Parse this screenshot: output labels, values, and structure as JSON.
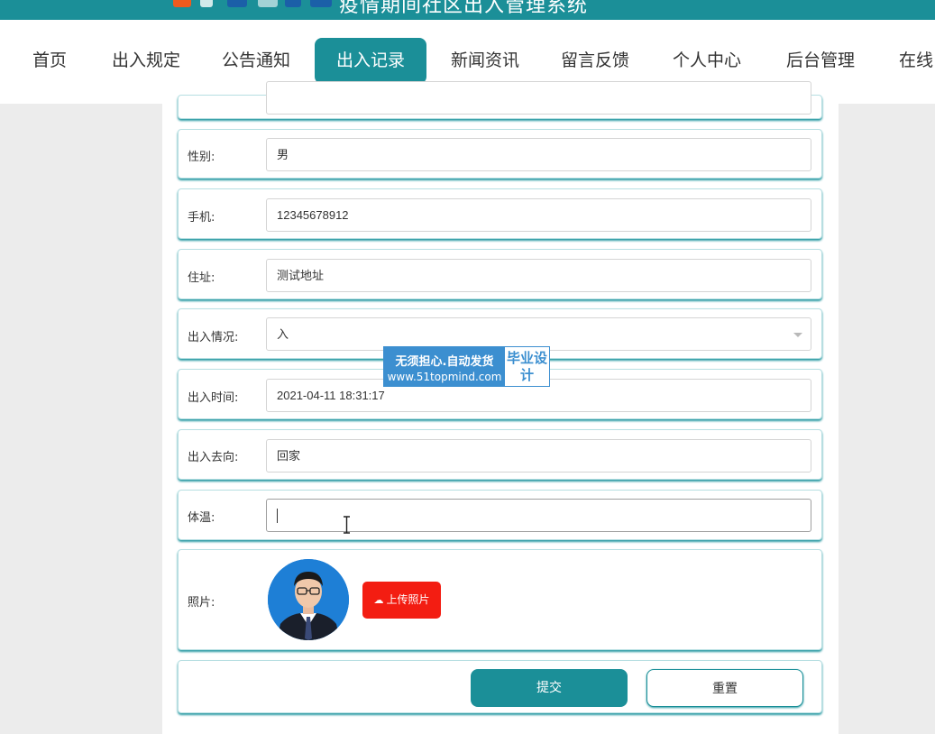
{
  "header": {
    "title": "疫情期间社区出入管理系统"
  },
  "nav": {
    "items": [
      {
        "label": "首页",
        "active": false
      },
      {
        "label": "出入规定",
        "active": false
      },
      {
        "label": "公告通知",
        "active": false
      },
      {
        "label": "出入记录",
        "active": true
      },
      {
        "label": "新闻资讯",
        "active": false
      },
      {
        "label": "留言反馈",
        "active": false
      },
      {
        "label": "个人中心",
        "active": false
      },
      {
        "label": "后台管理",
        "active": false
      },
      {
        "label": "在线",
        "active": false
      }
    ]
  },
  "form": {
    "gender": {
      "label": "性别:",
      "value": "男"
    },
    "phone": {
      "label": "手机:",
      "value": "12345678912"
    },
    "address": {
      "label": "住址:",
      "value": "测试地址"
    },
    "status": {
      "label": "出入情况:",
      "value": "入"
    },
    "time": {
      "label": "出入时间:",
      "value": "2021-04-11 18:31:17"
    },
    "direction": {
      "label": "出入去向:",
      "value": "回家"
    },
    "temperature": {
      "label": "体温:",
      "value": ""
    },
    "photo": {
      "label": "照片:",
      "upload_label": "上传照片"
    },
    "submit_label": "提交",
    "reset_label": "重置"
  },
  "watermark": {
    "line1": "无须担心.自动发货",
    "line2": "www.51topmind.com",
    "right": "毕业设计"
  },
  "colors": {
    "primary": "#1b8f98",
    "upload": "#f31d12",
    "background": "#ececec"
  }
}
